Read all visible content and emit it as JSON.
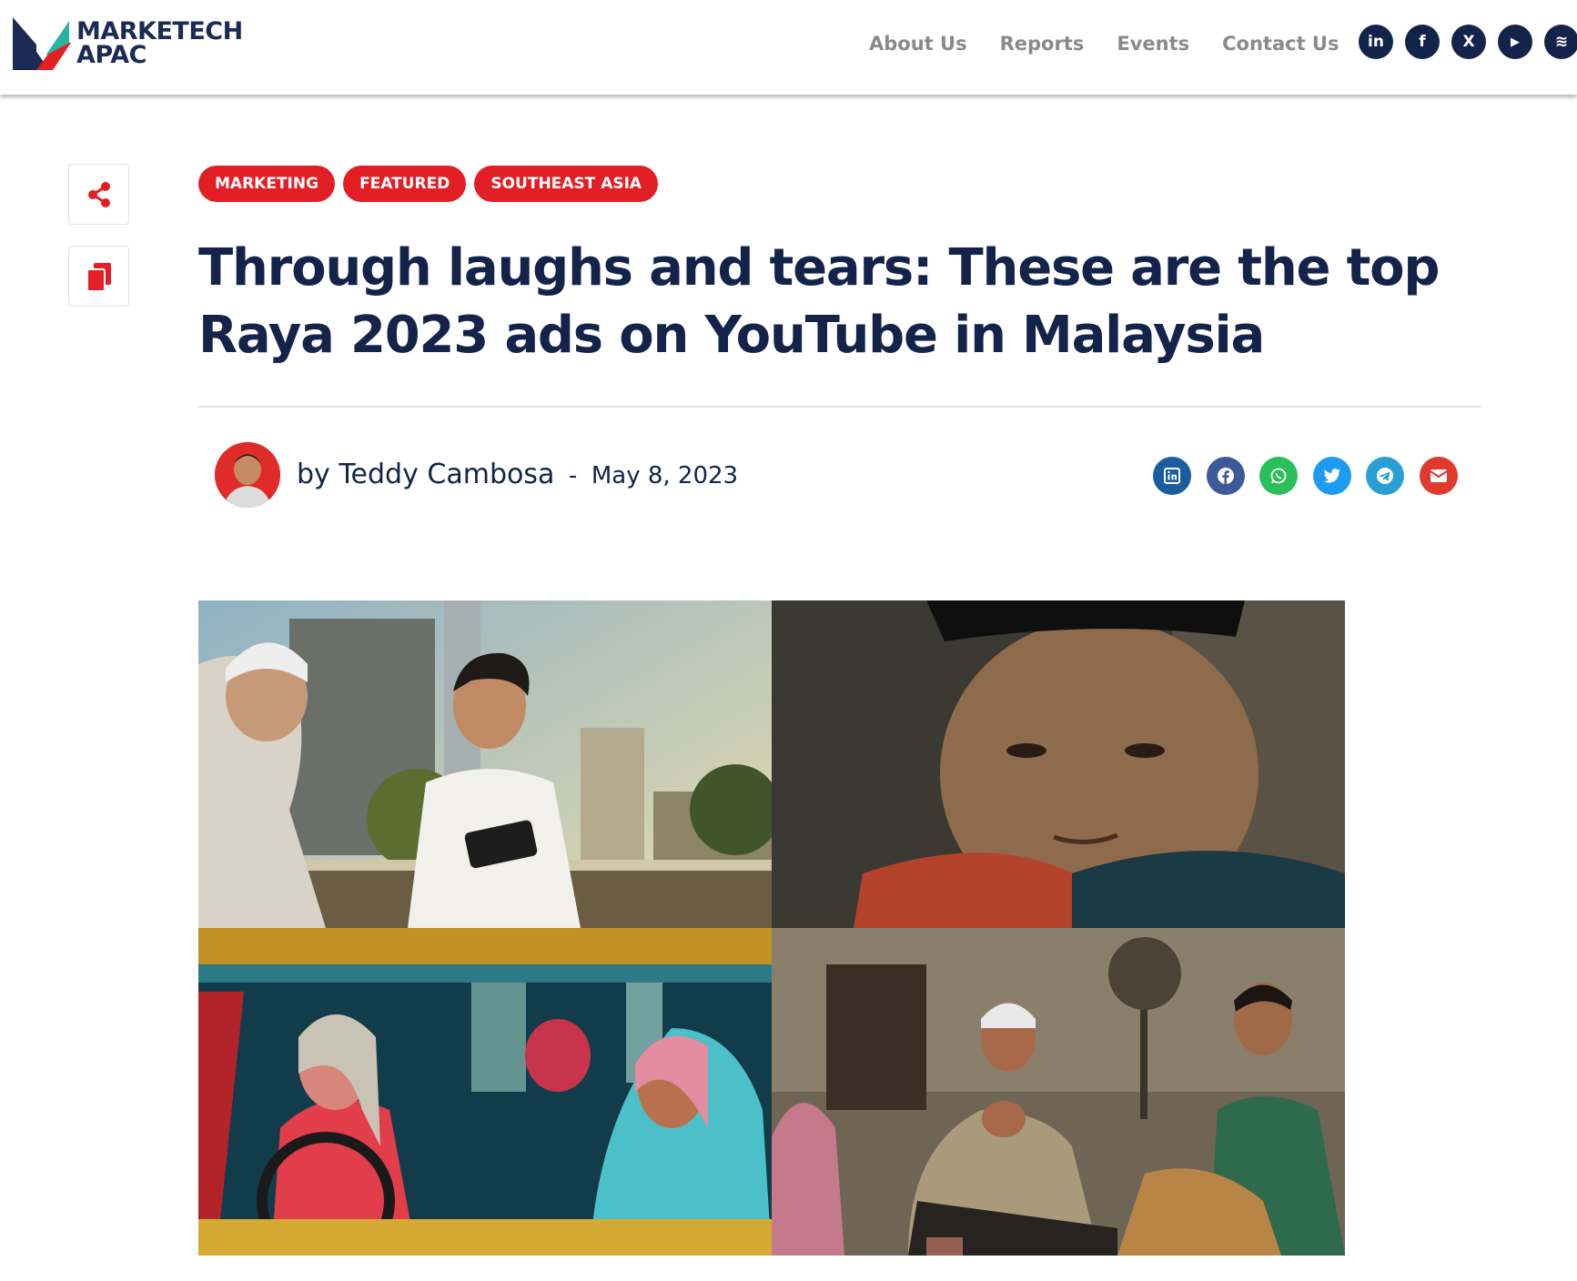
{
  "header": {
    "logo": {
      "line1": "MARKETECH",
      "line2": "APAC"
    },
    "nav": [
      "About Us",
      "Reports",
      "Events",
      "Contact Us"
    ],
    "social": [
      {
        "icon": "linkedin-icon",
        "glyph": "in"
      },
      {
        "icon": "facebook-icon",
        "glyph": "f"
      },
      {
        "icon": "x-icon",
        "glyph": "X"
      },
      {
        "icon": "youtube-icon",
        "glyph": "▶"
      },
      {
        "icon": "spotify-icon",
        "glyph": "≋"
      }
    ]
  },
  "article": {
    "tags": [
      "MARKETING",
      "FEATURED",
      "SOUTHEAST ASIA"
    ],
    "title": "Through laughs and tears: These are the top Raya 2023 ads on YouTube in Malaysia",
    "author": "by Teddy Cambosa",
    "separator": "-",
    "date": "May 8, 2023",
    "share": [
      {
        "icon": "linkedin-share-icon",
        "color": "#1a5da0"
      },
      {
        "icon": "facebook-share-icon",
        "color": "#3d5a98"
      },
      {
        "icon": "whatsapp-share-icon",
        "color": "#2bbf5a"
      },
      {
        "icon": "twitter-share-icon",
        "color": "#1d9bf0"
      },
      {
        "icon": "telegram-share-icon",
        "color": "#2a9fd6"
      },
      {
        "icon": "email-share-icon",
        "color": "#e0392d"
      }
    ]
  },
  "colors": {
    "brand_navy": "#13234a",
    "brand_red": "#e31e24",
    "nav_gray": "#8a8a8a"
  }
}
